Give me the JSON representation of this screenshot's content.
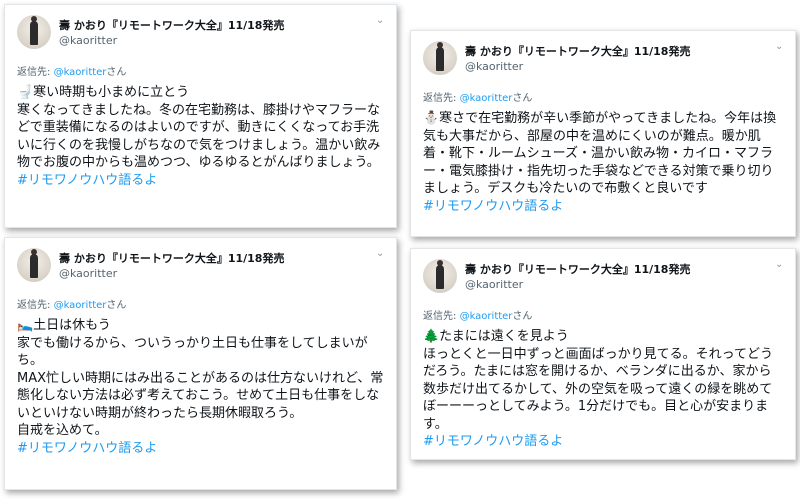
{
  "tweets": [
    {
      "name": "壽 かおり『リモートワーク大全』11/18発売",
      "handle": "@kaoritter",
      "reply_prefix": "返信先:",
      "reply_handle": "@kaoritter",
      "reply_suffix": "さん",
      "lines": [
        "🚽寒い時期も小まめに立とう",
        "寒くなってきましたね。冬の在宅勤務は、膝掛けやマフラーなどで重装備になるのはよいのですが、動きにくくなってお手洗いに行くのを我慢しがちなので気をつけましょう。温かい飲み物でお腹の中からも温めつつ、ゆるゆるとがんばりましょう。"
      ],
      "hashtag": "#リモワノウハウ語るよ"
    },
    {
      "name": "壽 かおり『リモートワーク大全』11/18発売",
      "handle": "@kaoritter",
      "reply_prefix": "返信先:",
      "reply_handle": "@kaoritter",
      "reply_suffix": "さん",
      "lines": [
        "⛄寒さで在宅勤務が辛い季節がやってきましたね。今年は換気も大事だから、部屋の中を温めにくいのが難点。暖か肌着・靴下・ルームシューズ・温かい飲み物・カイロ・マフラー・電気膝掛け・指先切った手袋などできる対策で乗り切りましょう。デスクも冷たいので布敷くと良いです"
      ],
      "hashtag": "#リモワノウハウ語るよ"
    },
    {
      "name": "壽 かおり『リモートワーク大全』11/18発売",
      "handle": "@kaoritter",
      "reply_prefix": "返信先:",
      "reply_handle": "@kaoritter",
      "reply_suffix": "さん",
      "lines": [
        "🛌土日は休もう",
        "家でも働けるから、ついうっかり土日も仕事をしてしまいがち。",
        "MAX忙しい時期にはみ出ることがあるのは仕方ないけれど、常態化しない方法は必ず考えておこう。せめて土日も仕事をしないといけない時期が終わったら長期休暇取ろう。",
        "自戒を込めて。"
      ],
      "hashtag": "#リモワノウハウ語るよ"
    },
    {
      "name": "壽 かおり『リモートワーク大全』11/18発売",
      "handle": "@kaoritter",
      "reply_prefix": "返信先:",
      "reply_handle": "@kaoritter",
      "reply_suffix": "さん",
      "lines": [
        "🌲たまには遠くを見よう",
        "ほっとくと一日中ずっと画面ばっかり見てる。それってどうだろう。たまには窓を開けるか、ベランダに出るか、家から数歩だけ出てるかして、外の空気を吸って遠くの緑を眺めてぼーーーっとしてみよう。1分だけでも。目と心が安まります。"
      ],
      "hashtag": "#リモワノウハウ語るよ"
    }
  ]
}
